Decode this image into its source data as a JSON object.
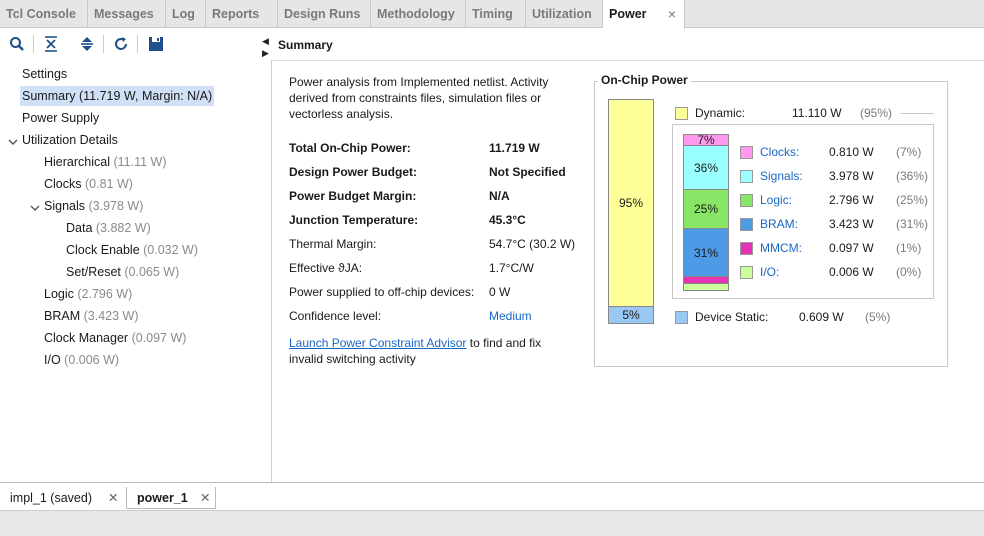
{
  "tabs": [
    "Tcl Console",
    "Messages",
    "Log",
    "Reports",
    "Design Runs",
    "Methodology",
    "Timing",
    "Utilization",
    "Power"
  ],
  "active_tab_close": "×",
  "toolbar_icons": [
    "search-icon",
    "collapse-all-icon",
    "expand-all-icon",
    "refresh-icon",
    "save-icon"
  ],
  "tree": {
    "settings": "Settings",
    "summary": "Summary (11.719 W, Margin: N/A)",
    "power_supply": "Power Supply",
    "utilization_details": "Utilization Details",
    "hierarchical": "Hierarchical",
    "hierarchical_val": "(11.11 W)",
    "clocks": "Clocks",
    "clocks_val": "(0.81 W)",
    "signals": "Signals",
    "signals_val": "(3.978 W)",
    "data": "Data",
    "data_val": "(3.882 W)",
    "clock_enable": "Clock Enable",
    "clock_enable_val": "(0.032 W)",
    "set_reset": "Set/Reset",
    "set_reset_val": "(0.065 W)",
    "logic": "Logic",
    "logic_val": "(2.796 W)",
    "bram": "BRAM",
    "bram_val": "(3.423 W)",
    "clock_manager": "Clock Manager",
    "clock_manager_val": "(0.097 W)",
    "io": "I/O",
    "io_val": "(0.006 W)"
  },
  "summary": {
    "title": "Summary",
    "description": "Power analysis from Implemented netlist. Activity derived from constraints files, simulation files or vectorless analysis.",
    "rows": [
      {
        "label": "Total On-Chip Power:",
        "value": "11.719 W"
      },
      {
        "label": "Design Power Budget:",
        "value": "Not Specified"
      },
      {
        "label": "Power Budget Margin:",
        "value": "N/A"
      },
      {
        "label": "Junction Temperature:",
        "value": "45.3°C"
      },
      {
        "label": "Thermal Margin:",
        "value": "54.7°C (30.2 W)"
      },
      {
        "label": "Effective ϑJA:",
        "value": "1.7°C/W"
      },
      {
        "label": "Power supplied to off-chip devices:",
        "value": "0 W"
      },
      {
        "label": "Confidence level:",
        "value": "Medium"
      }
    ],
    "advisor_link": "Launch Power Constraint Advisor",
    "advisor_text": " to find and fix invalid switching activity"
  },
  "chart": {
    "title": "On-Chip Power",
    "dynamic_label": "Dynamic:",
    "dynamic_value": "11.110 W",
    "dynamic_pct": "(95%)",
    "static_label": "Device Static:",
    "static_value": "0.609 W",
    "static_pct": "(5%)",
    "bar_dynamic_pct": "95%",
    "bar_static_pct": "5%",
    "colors": {
      "dynamic": "#ffff99",
      "static": "#99c8f4",
      "clocks": "#ff99ee",
      "signals": "#99ffff",
      "logic": "#88e566",
      "bram": "#4d9be6",
      "mmcm": "#e633b3",
      "io": "#ccff99"
    },
    "components": [
      {
        "name": "Clocks:",
        "value": "0.810 W",
        "pct": "(7%)",
        "share": 7,
        "bar_label": "7%"
      },
      {
        "name": "Signals:",
        "value": "3.978 W",
        "pct": "(36%)",
        "share": 36,
        "bar_label": "36%"
      },
      {
        "name": "Logic:",
        "value": "2.796 W",
        "pct": "(25%)",
        "share": 25,
        "bar_label": "25%"
      },
      {
        "name": "BRAM:",
        "value": "3.423 W",
        "pct": "(31%)",
        "share": 31,
        "bar_label": "31%"
      },
      {
        "name": "MMCM:",
        "value": "0.097 W",
        "pct": "(1%)",
        "share": 1,
        "bar_label": ""
      },
      {
        "name": "I/O:",
        "value": "0.006 W",
        "pct": "(0%)",
        "share": 0,
        "bar_label": ""
      }
    ]
  },
  "bottom_tabs": [
    {
      "label": "impl_1 (saved)"
    },
    {
      "label": "power_1"
    }
  ]
}
